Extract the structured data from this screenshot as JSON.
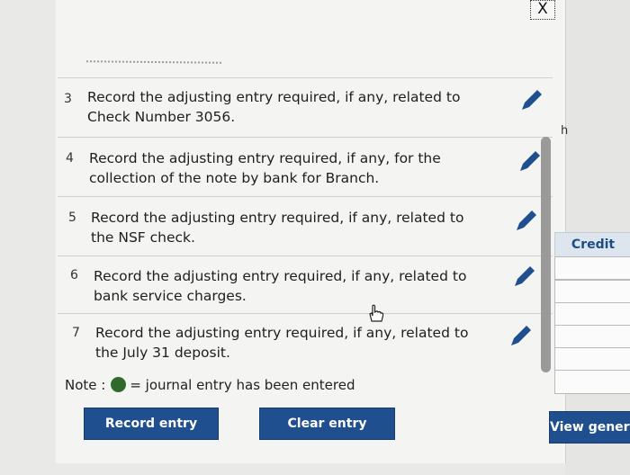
{
  "window": {
    "close_symbol": "X"
  },
  "entries": [
    {
      "number": "3",
      "text": "Record the adjusting entry required, if any, related to Check Number 3056.",
      "icon": "pencil-icon"
    },
    {
      "number": "4",
      "text": "Record the adjusting entry required, if any, for the collection of the note by bank for Branch.",
      "icon": "pencil-icon"
    },
    {
      "number": "5",
      "text": "Record the adjusting entry required, if any, related to the NSF check.",
      "icon": "pencil-icon"
    },
    {
      "number": "6",
      "text": "Record the adjusting entry required, if any, related to bank service charges.",
      "icon": "pencil-icon"
    },
    {
      "number": "7",
      "text": "Record the adjusting entry required, if any, related to the July 31 deposit.",
      "icon": "pencil-icon"
    }
  ],
  "note": {
    "prefix": "Note :",
    "suffix": "= journal entry has been entered",
    "dot_color": "#2f6a2c"
  },
  "buttons": {
    "record": "Record entry",
    "clear": "Clear entry",
    "view_general": "View general j"
  },
  "side": {
    "partial_letter": "h",
    "credit_header": "Credit"
  },
  "colors": {
    "button_blue": "#1f4f8f",
    "header_text": "#1d4d86"
  }
}
